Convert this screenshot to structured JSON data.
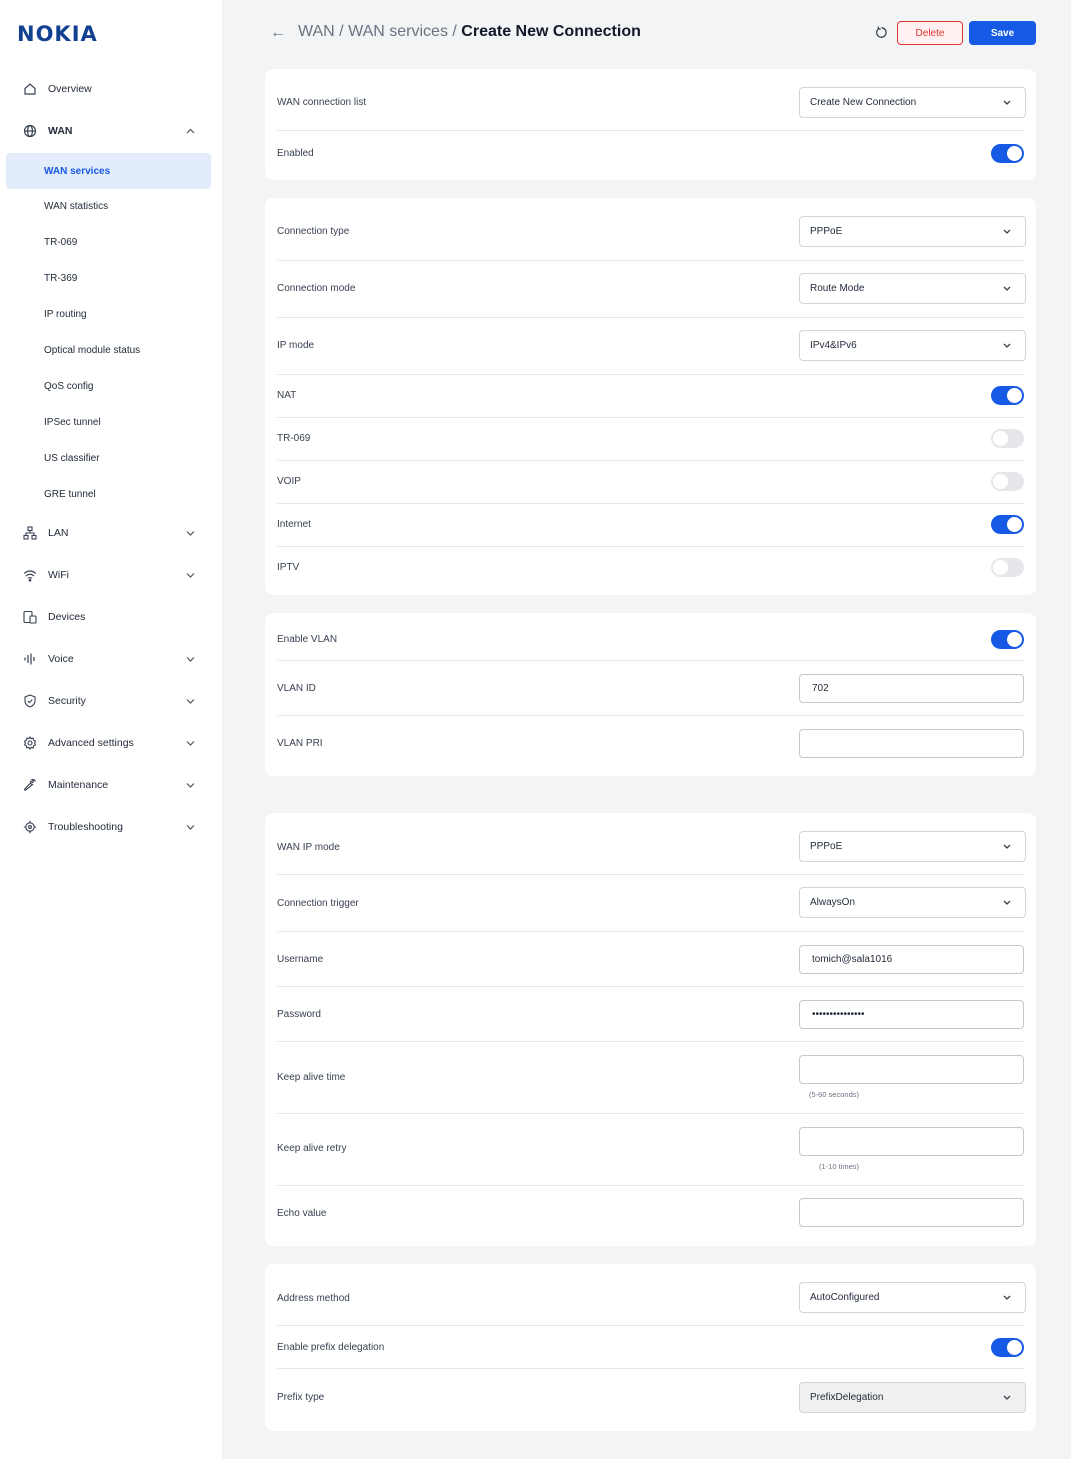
{
  "brand": {
    "logo": "NOKIA",
    "accent": "#1559e5",
    "danger": "#e3342f"
  },
  "sidebar": {
    "overview": "Overview",
    "wan": "WAN",
    "wan_items": [
      "WAN services",
      "WAN statistics",
      "TR-069",
      "TR-369",
      "IP routing",
      "Optical module status",
      "QoS config",
      "IPSec tunnel",
      "US classifier",
      "GRE tunnel"
    ],
    "active_item": "WAN services",
    "lan": "LAN",
    "wifi": "WiFi",
    "devices": "Devices",
    "voice": "Voice",
    "security": "Security",
    "advanced": "Advanced settings",
    "maintenance": "Maintenance",
    "troubleshooting": "Troubleshooting"
  },
  "header": {
    "crumb_1": "WAN",
    "crumb_sep": " / ",
    "crumb_2": "WAN services",
    "crumb_sep2": " / ",
    "current": "Create New Connection",
    "delete_label": "Delete",
    "save_label": "Save"
  },
  "section1": {
    "wan_list_label": "WAN connection list",
    "wan_list_value": "Create New Connection",
    "enabled_label": "Enabled",
    "enabled": true
  },
  "section2": {
    "conn_type_label": "Connection type",
    "conn_type_value": "PPPoE",
    "conn_mode_label": "Connection mode",
    "conn_mode_value": "Route Mode",
    "ip_mode_label": "IP mode",
    "ip_mode_value": "IPv4&IPv6",
    "nat_label": "NAT",
    "nat": true,
    "tr069_label": "TR-069",
    "tr069": false,
    "voip_label": "VOIP",
    "voip": false,
    "internet_label": "Internet",
    "internet": true,
    "iptv_label": "IPTV",
    "iptv": false
  },
  "section3": {
    "vlan_enable_label": "Enable VLAN",
    "vlan_enable": true,
    "vlan_id_label": "VLAN ID",
    "vlan_id_value": "702",
    "vlan_pri_label": "VLAN PRI",
    "vlan_pri_value": ""
  },
  "section4": {
    "wan_ip_mode_label": "WAN IP mode",
    "wan_ip_mode_value": "PPPoE",
    "trigger_label": "Connection trigger",
    "trigger_value": "AlwaysOn",
    "username_label": "Username",
    "username_value": "tomich@sala1016",
    "password_label": "Password",
    "password_value": "•••••••••••••••",
    "keepalive_time_label": "Keep alive time",
    "keepalive_time_value": "",
    "keepalive_time_hint": "(5-60 seconds)",
    "keepalive_retry_label": "Keep alive retry",
    "keepalive_retry_value": "",
    "keepalive_retry_hint": "(1-10 times)",
    "echo_label": "Echo value",
    "echo_value": ""
  },
  "section5": {
    "address_method_label": "Address method",
    "address_method_value": "AutoConfigured",
    "prefix_deleg_label": "Enable prefix delegation",
    "prefix_deleg": true,
    "prefix_type_label": "Prefix type",
    "prefix_type_value": "PrefixDelegation"
  }
}
